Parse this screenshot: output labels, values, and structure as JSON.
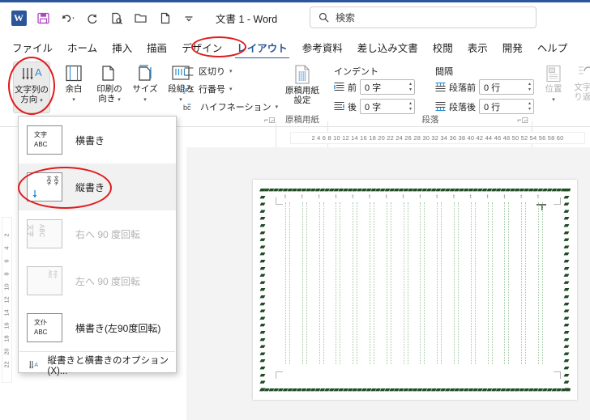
{
  "window": {
    "title": "文書 1  -  Word",
    "accent_color": "#2b579a",
    "annotation_color": "#e01b1b"
  },
  "quick_access": {
    "items": [
      {
        "name": "word-logo",
        "label": "W"
      },
      {
        "name": "save-icon",
        "label": "保存"
      },
      {
        "name": "undo-icon",
        "label": "元に戻す"
      },
      {
        "name": "redo-icon",
        "label": "やり直し"
      },
      {
        "name": "print-preview-icon",
        "label": "印刷プレビューと印刷"
      },
      {
        "name": "open-icon",
        "label": "開く"
      },
      {
        "name": "new-document-icon",
        "label": "新規"
      },
      {
        "name": "customize-qat-icon",
        "label": "クイック アクセス ツール バーのユーザー設定"
      }
    ]
  },
  "search": {
    "placeholder": "検索",
    "icon": "search-icon"
  },
  "tabs": [
    {
      "label": "ファイル",
      "active": false
    },
    {
      "label": "ホーム",
      "active": false
    },
    {
      "label": "挿入",
      "active": false
    },
    {
      "label": "描画",
      "active": false
    },
    {
      "label": "デザイン",
      "active": false
    },
    {
      "label": "レイアウト",
      "active": true
    },
    {
      "label": "参考資料",
      "active": false
    },
    {
      "label": "差し込み文書",
      "active": false
    },
    {
      "label": "校閲",
      "active": false
    },
    {
      "label": "表示",
      "active": false
    },
    {
      "label": "開発",
      "active": false
    },
    {
      "label": "ヘルプ",
      "active": false
    }
  ],
  "ribbon": {
    "page_setup": {
      "group_label": "",
      "buttons": [
        {
          "name": "text-direction-button",
          "line1": "文字列の",
          "line2": "方向",
          "has_chevron": true,
          "pressed": true
        },
        {
          "name": "margins-button",
          "line1": "余白",
          "line2": "",
          "has_chevron": true,
          "pressed": false
        },
        {
          "name": "orientation-button",
          "line1": "印刷の",
          "line2": "向き",
          "has_chevron": true,
          "pressed": false
        },
        {
          "name": "size-button",
          "line1": "サイズ",
          "line2": "",
          "has_chevron": true,
          "pressed": false
        },
        {
          "name": "columns-button",
          "line1": "段組み",
          "line2": "",
          "has_chevron": true,
          "pressed": false
        }
      ],
      "small_items": [
        {
          "name": "breaks-menu",
          "label": "区切り",
          "has_chevron": true
        },
        {
          "name": "line-numbers-menu",
          "label": "行番号",
          "has_chevron": true
        },
        {
          "name": "hyphenation-menu",
          "label": "ハイフネーション",
          "has_chevron": true
        }
      ],
      "launcher": "page-setup-dialog-launcher"
    },
    "manuscript": {
      "group_label": "原稿用紙",
      "button": {
        "name": "manuscript-settings-button",
        "line1": "原稿用紙",
        "line2": "設定"
      }
    },
    "paragraph": {
      "group_label": "段落",
      "indent_header": "インデント",
      "spacing_header": "間隔",
      "fields": [
        {
          "name": "indent-left-field",
          "label": "前",
          "value": "0 字"
        },
        {
          "name": "indent-right-field",
          "label": "後",
          "value": "0 字"
        },
        {
          "name": "spacing-before-field",
          "label": "段落前",
          "value": "0 行"
        },
        {
          "name": "spacing-after-field",
          "label": "段落後",
          "value": "0 行"
        }
      ],
      "launcher": "paragraph-dialog-launcher"
    },
    "arrange": {
      "buttons": [
        {
          "name": "position-button",
          "line1": "位置",
          "line2": "",
          "has_chevron": true
        },
        {
          "name": "wrap-text-button",
          "line1": "文字列",
          "line2": "り返し",
          "has_chevron": false
        }
      ]
    }
  },
  "text_direction_menu": {
    "items": [
      {
        "name": "menu-item-horizontal",
        "label": "横書き",
        "thumb_lines": [
          "文字",
          "ABC"
        ],
        "disabled": false,
        "highlighted": false,
        "circled": false
      },
      {
        "name": "menu-item-vertical",
        "label": "縦書き",
        "thumb_lines": [
          "文字",
          "文字"
        ],
        "disabled": false,
        "highlighted": true,
        "circled": true
      },
      {
        "name": "menu-item-rotate-right-90",
        "label": "右へ 90 度回転",
        "thumb_lines": [
          "文字",
          "ABC"
        ],
        "disabled": true,
        "highlighted": false,
        "circled": false
      },
      {
        "name": "menu-item-rotate-left-90",
        "label": "左へ 90 度回転",
        "thumb_lines": [
          "文字",
          "ABC"
        ],
        "disabled": true,
        "highlighted": false,
        "circled": false
      },
      {
        "name": "menu-item-horizontal-rotate-left-90",
        "label": "横書き(左90度回転)",
        "thumb_lines": [
          "文仆",
          "ABC"
        ],
        "disabled": false,
        "highlighted": false,
        "circled": false
      }
    ],
    "options_item": {
      "name": "menu-item-text-direction-options",
      "label": "縦書きと横書きのオプション(X)...",
      "icon": "text-direction-icon"
    }
  },
  "rulers": {
    "horizontal": "2  4  6   8  10 12 14 16  18 20 22  24 26  28 30 32  34 36 38  40 42  44 46 48  50 52 54  56 58 60",
    "vertical": [
      "2",
      "4",
      "6",
      "8",
      "10",
      "12",
      "14",
      "16",
      "18",
      "20",
      "22"
    ]
  },
  "document": {
    "page_border_style": "art-border-green-zigzag",
    "border_color": "#1f4d24",
    "grid_color": "#9fc99f",
    "column_count": 16,
    "column_mark": "t"
  },
  "annotations": [
    {
      "name": "annotation-text-direction-button",
      "target": "text-direction-button"
    },
    {
      "name": "annotation-layout-tab",
      "target": "tab-layout"
    },
    {
      "name": "annotation-menu-item-vertical",
      "target": "menu-item-vertical"
    }
  ]
}
